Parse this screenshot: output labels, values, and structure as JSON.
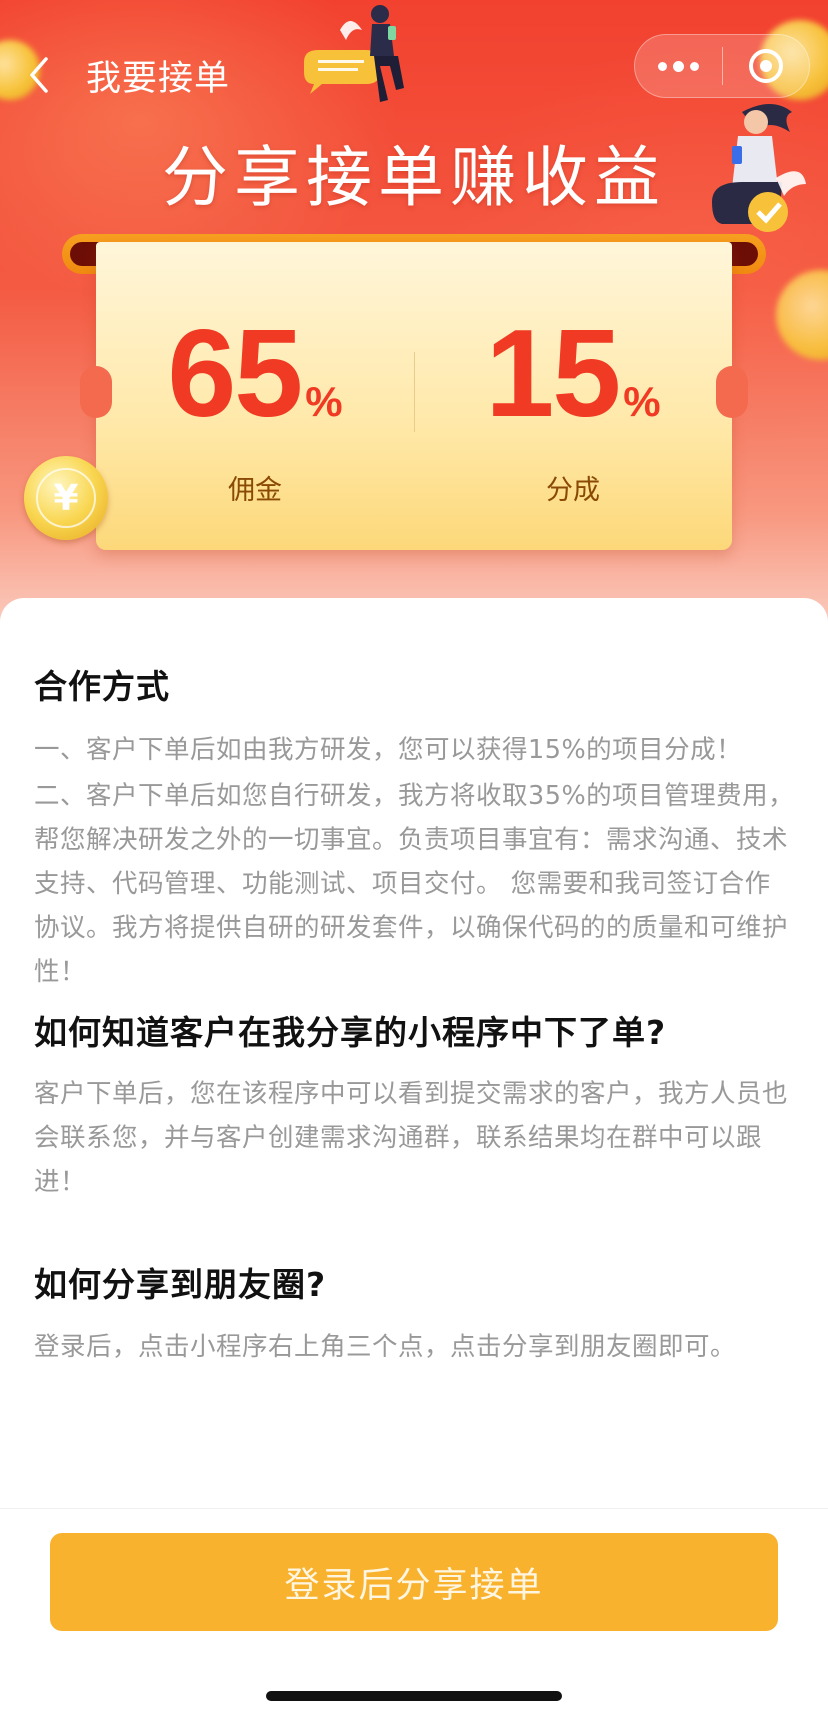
{
  "nav": {
    "title": "我要接单"
  },
  "hero": {
    "title": "分享接单赚收益",
    "commission": {
      "value": "65",
      "unit": "%",
      "label": "佣金"
    },
    "share": {
      "value": "15",
      "unit": "%",
      "label": "分成"
    }
  },
  "sections": [
    {
      "title": "合作方式",
      "paragraphs": [
        "一、客户下单后如由我方研发，您可以获得15%的项目分成！",
        "二、客户下单后如您自行研发，我方将收取35%的项目管理费用，帮您解决研发之外的一切事宜。负责项目事宜有：需求沟通、技术支持、代码管理、功能测试、项目交付。 您需要和我司签订合作协议。我方将提供自研的研发套件，以确保代码的的质量和可维护性！"
      ]
    },
    {
      "title": "如何知道客户在我分享的小程序中下了单?",
      "paragraphs": [
        "客户下单后，您在该程序中可以看到提交需求的客户，我方人员也会联系您，并与客户创建需求沟通群，联系结果均在群中可以跟进！"
      ]
    },
    {
      "title": "如何分享到朋友圈?",
      "paragraphs": [
        "登录后，点击小程序右上角三个点，点击分享到朋友圈即可。"
      ]
    }
  ],
  "cta": {
    "label": "登录后分享接单"
  },
  "icons": {
    "back": "chevron-left-icon",
    "more": "more-dots-icon",
    "close": "target-icon",
    "coin": "yen-coin-icon"
  },
  "colors": {
    "hero_red": "#f2412f",
    "stat_red": "#f03a23",
    "cta_orange": "#f8b22e",
    "body_gray": "#999999"
  }
}
